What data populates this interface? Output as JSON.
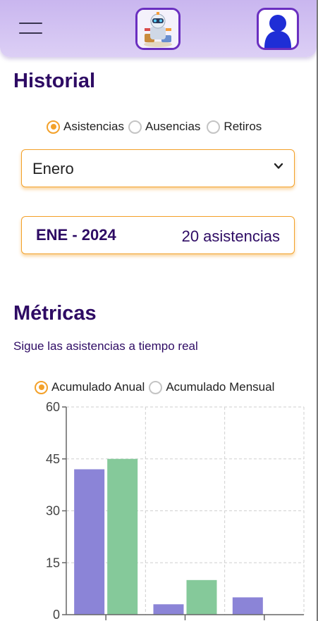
{
  "header": {
    "menu_icon": "hamburger-menu-icon",
    "logo_icon": "robot-mascot-logo",
    "avatar_icon": "user-silhouette-icon"
  },
  "historial": {
    "title": "Historial",
    "filters": [
      {
        "label": "Asistencias",
        "selected": true
      },
      {
        "label": "Ausencias",
        "selected": false
      },
      {
        "label": "Retiros",
        "selected": false
      }
    ],
    "month_select": {
      "value": "Enero"
    },
    "summary": {
      "period": "ENE - 2024",
      "count_text": "20 asistencias"
    }
  },
  "metricas": {
    "title": "Métricas",
    "subtitle": "Sigue las asistencias a tiempo real",
    "modes": [
      {
        "label": "Acumulado Anual",
        "selected": true
      },
      {
        "label": "Acumulado Mensual",
        "selected": false
      }
    ]
  },
  "colors": {
    "accent": "#f3a12a",
    "title": "#2e0b64",
    "series_purple": "#8b84d7",
    "series_green": "#85c99a",
    "header_bg": "#cdbaf0"
  },
  "chart_data": {
    "type": "bar",
    "categories": [
      "",
      "",
      ""
    ],
    "series": [
      {
        "values": [
          42,
          3,
          5
        ],
        "color": "#8b84d7"
      },
      {
        "values": [
          45,
          10,
          0
        ],
        "color": "#85c99a"
      }
    ],
    "yticks": [
      0,
      15,
      30,
      45,
      60
    ],
    "ylim": [
      0,
      60
    ],
    "grid": true
  }
}
